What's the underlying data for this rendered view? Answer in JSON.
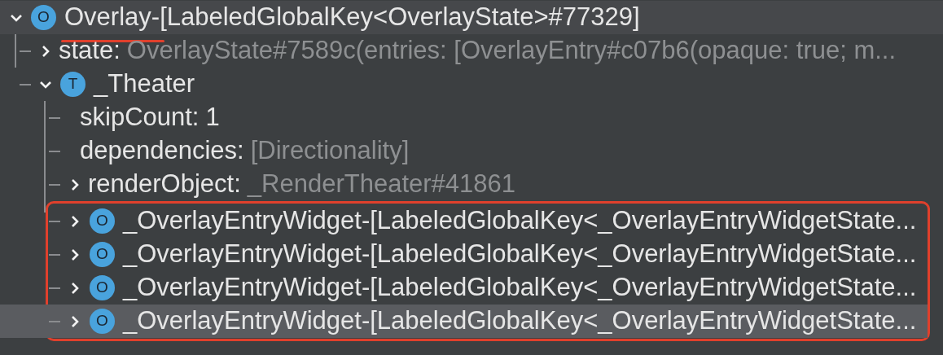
{
  "tree": {
    "kind": "node",
    "badge": "O",
    "name": "Overlay-",
    "key": "[LabeledGlobalKey<OverlayState>#77329]",
    "underlined": true,
    "expanded": true,
    "hovered": true,
    "selected": false,
    "children": [
      {
        "kind": "property",
        "name": "state:",
        "value": "OverlayState#7589c(entries: [OverlayEntry#c07b6(opaque: true; m...",
        "dimmed": true,
        "expandable": true,
        "expanded": false
      },
      {
        "kind": "node",
        "badge": "T",
        "name": "_Theater",
        "expanded": true,
        "hovered": false,
        "selected": false,
        "children": [
          {
            "kind": "property",
            "name": "skipCount:",
            "value": "1",
            "dimmed": false,
            "expandable": false
          },
          {
            "kind": "property",
            "name": "dependencies:",
            "value": "[Directionality]",
            "dimmed": true,
            "expandable": false
          },
          {
            "kind": "property",
            "name": "renderObject:",
            "value": "_RenderTheater#41861",
            "dimmed": true,
            "expandable": true,
            "expanded": false
          },
          {
            "kind": "node",
            "badge": "O",
            "name": "_OverlayEntryWidget-[LabeledGlobalKey<_OverlayEntryWidgetState...",
            "expanded": false,
            "outlined": true,
            "hovered": false,
            "selected": false
          },
          {
            "kind": "node",
            "badge": "O",
            "name": "_OverlayEntryWidget-[LabeledGlobalKey<_OverlayEntryWidgetState...",
            "expanded": false,
            "outlined": true,
            "hovered": false,
            "selected": false
          },
          {
            "kind": "node",
            "badge": "O",
            "name": "_OverlayEntryWidget-[LabeledGlobalKey<_OverlayEntryWidgetState...",
            "expanded": false,
            "outlined": true,
            "hovered": false,
            "selected": false
          },
          {
            "kind": "node",
            "badge": "O",
            "name": "_OverlayEntryWidget-[LabeledGlobalKey<_OverlayEntryWidgetState...",
            "expanded": false,
            "outlined": true,
            "hovered": false,
            "selected": true
          }
        ]
      }
    ]
  }
}
